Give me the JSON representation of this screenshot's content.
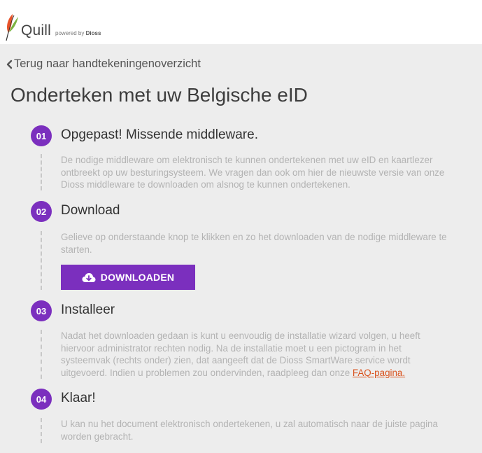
{
  "header": {
    "app_name": "Quill",
    "powered_by_prefix": "powered by",
    "powered_by_brand": "Dioss"
  },
  "nav": {
    "back_label": "Terug naar handtekeningenoverzicht"
  },
  "page": {
    "title": "Onderteken met uw Belgische eID"
  },
  "steps": [
    {
      "number": "01",
      "title": "Opgepast! Missende middleware.",
      "text": "De nodige middleware om elektronisch te kunnen ondertekenen met uw eID en kaartlezer ontbreekt op uw besturingsysteem. We vragen dan ook om hier de nieuwste versie van onze Dioss middleware te downloaden om alsnog te kunnen ondertekenen."
    },
    {
      "number": "02",
      "title": "Download",
      "text": "Gelieve op onderstaande knop te klikken en zo het downloaden van de nodige middleware te starten.",
      "button_label": "DOWNLOADEN"
    },
    {
      "number": "03",
      "title": "Installeer",
      "text": "Nadat het downloaden gedaan is kunt u eenvoudig de installatie wizard volgen, u heeft hiervoor administrator rechten nodig. Na de installatie moet u een pictogram in het systeemvak (rechts onder) zien, dat aangeeft dat de Dioss SmartWare service wordt uitgevoerd. Indien u problemen zou ondervinden, raadpleeg dan onze",
      "link_label": "FAQ-pagina."
    },
    {
      "number": "04",
      "title": "Klaar!",
      "text": "U kan nu het document elektronisch ondertekenen, u zal automatisch naar de juiste pagina worden gebracht."
    }
  ],
  "colors": {
    "accent": "#7b2fbe",
    "link": "#d9531e",
    "muted_text": "#b3b3b3",
    "background": "#ededed"
  },
  "icons": {
    "logo": "quill-feather-icon",
    "back": "chevron-left-icon",
    "download": "cloud-download-icon"
  }
}
